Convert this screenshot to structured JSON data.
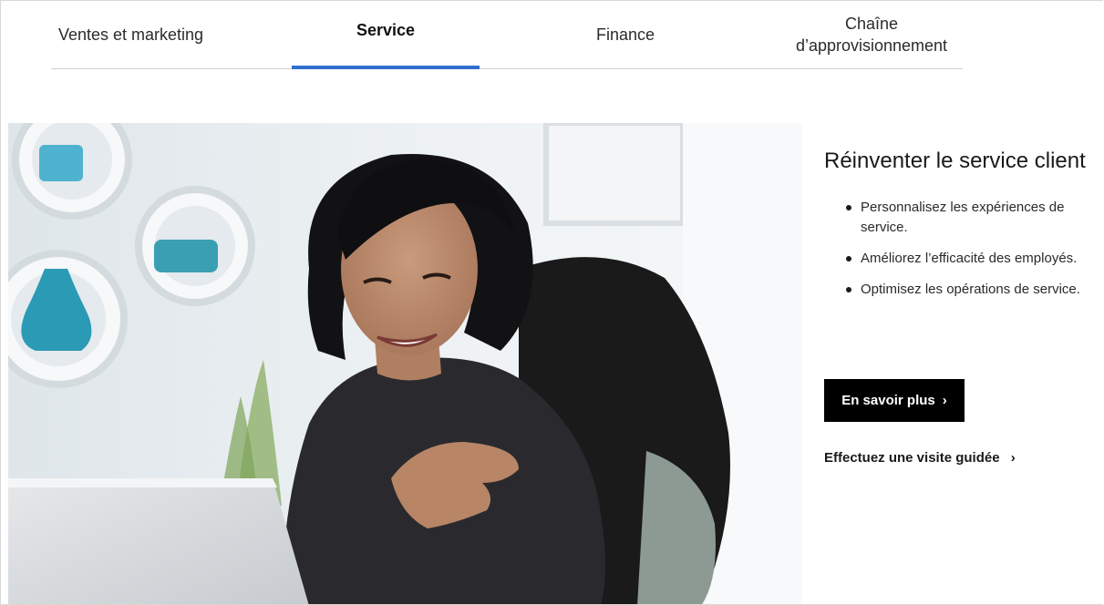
{
  "tabs": [
    {
      "label": "Ventes et marketing"
    },
    {
      "label": "Service"
    },
    {
      "label": "Finance"
    },
    {
      "label": "Chaîne d’approvisionnement"
    }
  ],
  "active_tab": "Service",
  "hero": {
    "image": "woman-smiling-at-laptop-photo"
  },
  "panel": {
    "title": "Réinventer le service client",
    "bullets": [
      "Personnalisez les expériences de service.",
      "Améliorez l’efficacité des employés.",
      "Optimisez les opérations de service."
    ],
    "cta_label": "En savoir plus",
    "tour_label": "Effectuez une visite guidée",
    "chevron": "›"
  },
  "colors": {
    "tab_indicator": "#2f6fd0",
    "cta_bg": "#000000"
  }
}
